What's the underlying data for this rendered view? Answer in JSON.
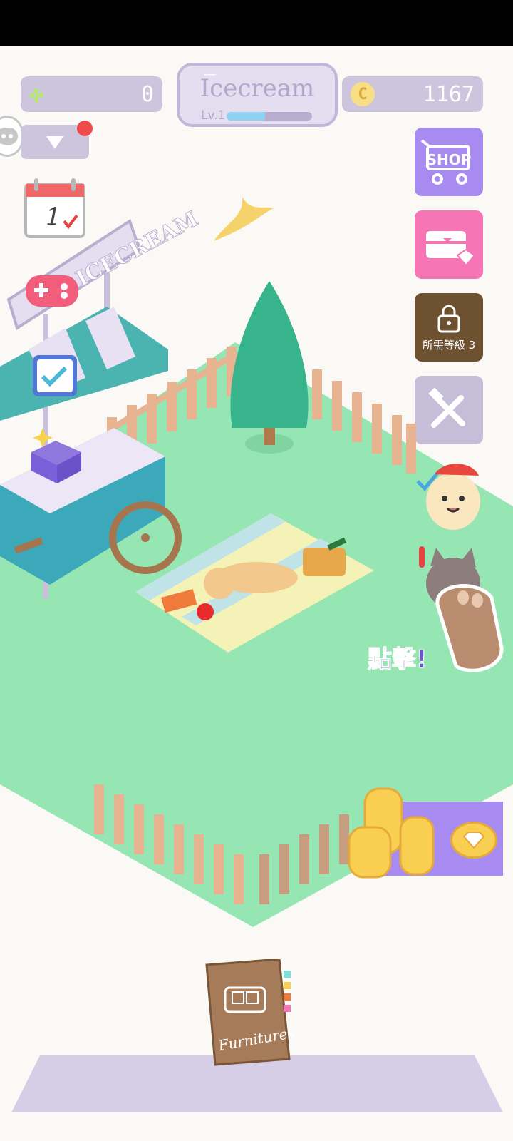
{
  "hud": {
    "clovers": "0",
    "coins": "1167",
    "coin_symbol": "C",
    "dash": "—",
    "shop_name": "Icecream",
    "level_label": "Lv.1",
    "level_progress": 0.45
  },
  "sidebar": {
    "shop_label": "SHOP",
    "locked_requirement": "所需等級 3"
  },
  "calendar": {
    "day": "1"
  },
  "cart_sign": {
    "text": "ICECREAM"
  },
  "tap_hint": "點擊!",
  "furniture_book": {
    "label": "Furnitures"
  },
  "colors": {
    "grass": "#95e6b3",
    "fence": "#e8b390",
    "shop_button": "#a88bf0",
    "chest_button": "#f676b5",
    "locked_button": "#6e5131",
    "tools_button": "#c6bdd9",
    "hud_pill": "#cdc4dd",
    "hint_text": "#6d55c9",
    "notification": "#f04b4b"
  }
}
